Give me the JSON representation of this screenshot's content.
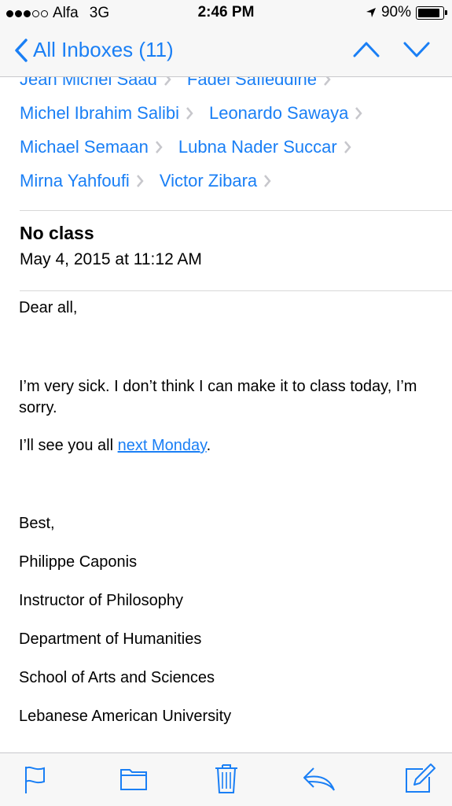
{
  "status_bar": {
    "carrier": "Alfa",
    "network": "3G",
    "time": "2:46 PM",
    "battery": "90%",
    "battery_level": 0.9,
    "signal_bars": 3,
    "signal_total": 5
  },
  "nav": {
    "back_label": "All Inboxes (11)",
    "accent": "#1a7ff5"
  },
  "recipients": [
    [
      "Jean Michel Saad",
      "Fadel Safieddine"
    ],
    [
      "Michel Ibrahim Salibi",
      "Leonardo Sawaya"
    ],
    [
      "Michael Semaan",
      "Lubna Nader Succar"
    ],
    [
      "Mirna Yahfoufi",
      "Victor Zibara"
    ]
  ],
  "message": {
    "subject": "No class",
    "date": "May 4, 2015 at 11:12 AM",
    "greeting": "Dear all,",
    "paragraph1": "I’m very sick. I don’t think I can make it to class today, I’m sorry.",
    "paragraph2_prefix": "I’ll see you all ",
    "paragraph2_link": "next Monday",
    "paragraph2_suffix": ".",
    "sign_off": "Best,",
    "signature": [
      "Philippe Caponis",
      "Instructor of Philosophy",
      "Department of Humanities",
      "School of Arts and Sciences",
      "Lebanese American University"
    ]
  },
  "toolbar": {
    "icons": [
      "flag-icon",
      "folder-icon",
      "trash-icon",
      "reply-icon",
      "compose-icon"
    ]
  }
}
